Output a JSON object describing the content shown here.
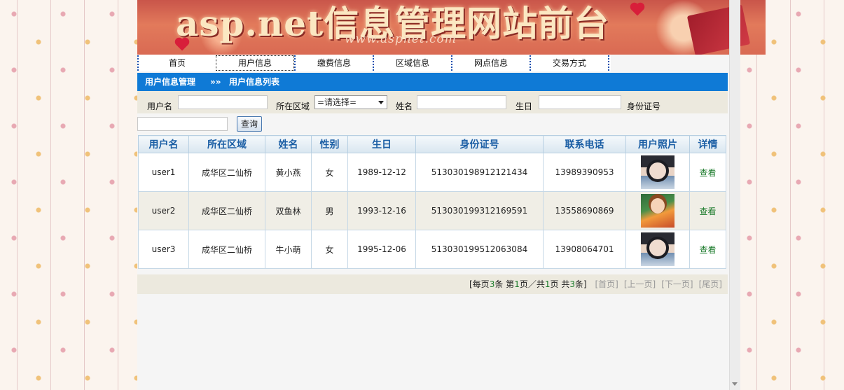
{
  "banner": {
    "title": "asp.net信息管理网站前台",
    "url": "www.aspnet.com"
  },
  "nav": [
    {
      "label": "首页"
    },
    {
      "label": "用户信息"
    },
    {
      "label": "缴费信息"
    },
    {
      "label": "区域信息"
    },
    {
      "label": "网点信息"
    },
    {
      "label": "交易方式"
    }
  ],
  "section": {
    "parent": "用户信息管理",
    "sep": "»»",
    "current": "用户信息列表"
  },
  "search": {
    "username_label": "用户名",
    "region_label": "所在区域",
    "region_value": "=请选择=",
    "name_label": "姓名",
    "birthday_label": "生日",
    "idcard_label": "身份证号",
    "query_button": "查询"
  },
  "table": {
    "headers": [
      "用户名",
      "所在区域",
      "姓名",
      "性别",
      "生日",
      "身份证号",
      "联系电话",
      "用户照片",
      "详情"
    ],
    "rows": [
      {
        "username": "user1",
        "region": "成华区二仙桥",
        "name": "黄小燕",
        "gender": "女",
        "birthday": "1989-12-12",
        "idcard": "513030198912121434",
        "phone": "13989390953",
        "photo": "girl-portrait-dark-hair",
        "action": "查看"
      },
      {
        "username": "user2",
        "region": "成华区二仙桥",
        "name": "双鱼林",
        "gender": "男",
        "birthday": "1993-12-16",
        "idcard": "513030199312169591",
        "phone": "13558690869",
        "photo": "girl-portrait-outdoor",
        "action": "查看"
      },
      {
        "username": "user3",
        "region": "成华区二仙桥",
        "name": "牛小萌",
        "gender": "女",
        "birthday": "1995-12-06",
        "idcard": "513030199512063084",
        "phone": "13908064701",
        "photo": "girl-portrait-dark-hair",
        "action": "查看"
      }
    ]
  },
  "pager": {
    "per_page_prefix": "[每页",
    "per_page": "3",
    "per_page_suffix": "条",
    "page_prefix": "第",
    "page_current": "1",
    "page_mid": "页／共",
    "page_total": "1",
    "page_suffix": "页",
    "total_prefix": "共",
    "total": "3",
    "total_suffix": "条]",
    "first": "[首页]",
    "prev": "[上一页]",
    "next": "[下一页]",
    "last": "[尾页]"
  }
}
